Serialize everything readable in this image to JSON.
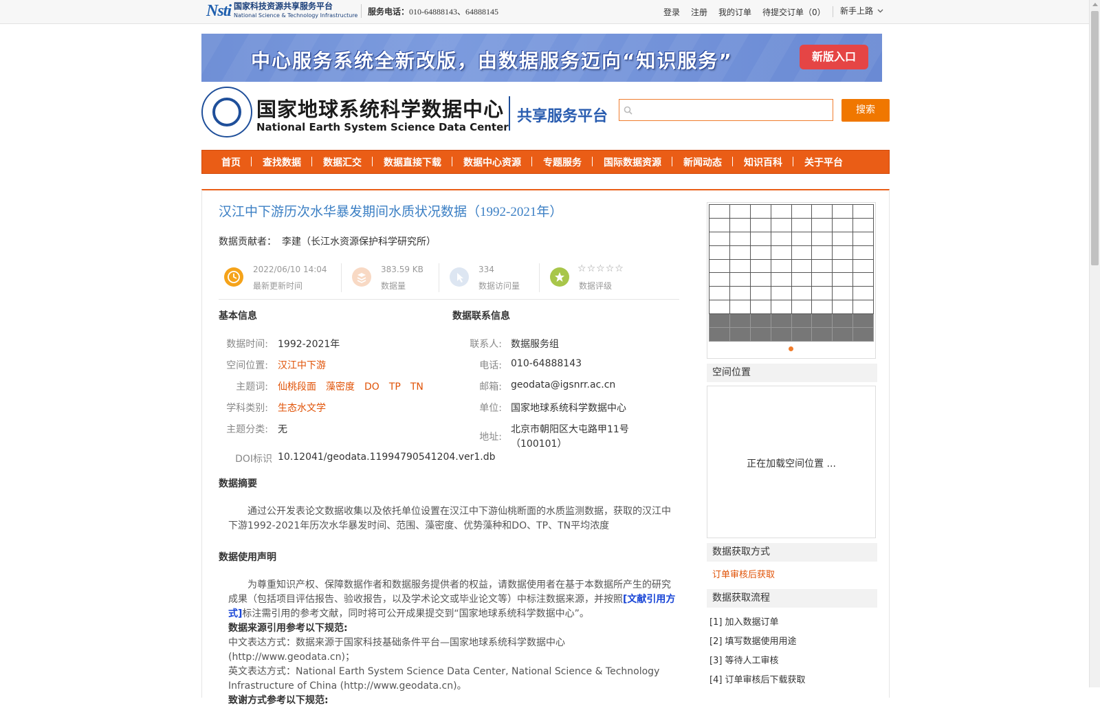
{
  "topbar": {
    "nsti_mark": "Nsti",
    "nsti_cn": "国家科技资源共享服务平台",
    "nsti_en": "National Science & Technology Infrastructure",
    "phone_label": "服务电话：",
    "phone_value": "010-64888143、64888145",
    "links": [
      "登录",
      "注册",
      "我的订单",
      "待提交订单（0）"
    ],
    "guide": "新手上路"
  },
  "banner": {
    "text": "中心服务系统全新改版，由数据服务迈向“知识服务”",
    "button": "新版入口"
  },
  "header": {
    "center_cn": "国家地球系统科学数据中心",
    "center_en": "National Earth System Science Data Center",
    "platform": "共享服务平台",
    "search_placeholder": "",
    "search_button": "搜索"
  },
  "nav": [
    "首页",
    "查找数据",
    "数据汇交",
    "数据直接下载",
    "数据中心资源",
    "专题服务",
    "国际数据资源",
    "新闻动态",
    "知识百科",
    "关于平台"
  ],
  "dataset": {
    "title": "汉江中下游历次水华暴发期间水质状况数据（1992-2021年）",
    "contributor_label": "数据贡献者：",
    "contributor": "李建（长江水资源保护科学研究所）",
    "stats": [
      {
        "value": "2022/06/10 14:04",
        "caption": "最新更新时间",
        "icon": "clock-icon",
        "color": "#f5a31a"
      },
      {
        "value": "383.59 KB",
        "caption": "数据量",
        "icon": "layers-icon",
        "color": "#f8d9c4"
      },
      {
        "value": "334",
        "caption": "数据访问量",
        "icon": "pointer-icon",
        "color": "#dde6f2"
      },
      {
        "value": "",
        "caption": "数据评级",
        "icon": "star-badge-icon",
        "color": "#a8c64a"
      }
    ],
    "rating": 0
  },
  "basic_info": {
    "heading": "基本信息",
    "rows": [
      {
        "label": "数据时间:",
        "value": "1992-2021年"
      },
      {
        "label": "空间位置:",
        "value": "汉江中下游"
      },
      {
        "label": "主题词:",
        "values": [
          "仙桃段面",
          "藻密度",
          "DO",
          "TP",
          "TN"
        ]
      },
      {
        "label": "学科类别:",
        "value": "生态水文学"
      },
      {
        "label": "主题分类:",
        "value": "无"
      },
      {
        "label": "DOI标识",
        "value": "10.12041/geodata.11994790541204.ver1.db"
      }
    ]
  },
  "contact_info": {
    "heading": "数据联系信息",
    "rows": [
      {
        "label": "联系人:",
        "value": "数据服务组"
      },
      {
        "label": "电话:",
        "value": "010-64888143"
      },
      {
        "label": "邮箱:",
        "value": "geodata@igsnrr.ac.cn"
      },
      {
        "label": "单位:",
        "value": "国家地球系统科学数据中心"
      },
      {
        "label": "地址:",
        "value_line1": "北京市朝阳区大屯路甲11号",
        "value_line2": "（100101）"
      }
    ]
  },
  "abstract": {
    "heading": "数据摘要",
    "text": "通过公开发表论文数据收集以及依托单位设置在汉江中下游仙桃断面的水质监测数据，获取的汉江中下游1992-2021年历次水华暴发时间、范围、藻密度、优势藻种和DO、TP、TN平均浓度"
  },
  "usage": {
    "heading": "数据使用声明",
    "p1_a": "为尊重知识产权、保障数据作者和数据服务提供者的权益，请数据使用者在基于本数据所产生的研究成果（包括项目评估报告、验收报告，以及学术论文或毕业论文等）中标注数据来源，并按照",
    "p1_link": "[文献引用方式]",
    "p1_b": "标注需引用的参考文献，同时将可公开成果提交到“国家地球系统科学数据中心”。",
    "source_heading": "数据来源引用参考以下规范:",
    "source_cn": "中文表达方式：数据来源于国家科技基础条件平台—国家地球系统科学数据中心(http://www.geodata.cn)；",
    "source_en": "英文表达方式：National Earth System Science Data Center, National Science & Technology Infrastructure of China (http://www.geodata.cn)。",
    "thanks_heading": "致谢方式参考以下规范:"
  },
  "sidebar": {
    "spatial_heading": "空间位置",
    "map_loading": "正在加载空间位置 ...",
    "access_heading": "数据获取方式",
    "access_value": "订单审核后获取",
    "process_heading": "数据获取流程",
    "steps": [
      "[1] 加入数据订单",
      "[2] 填写数据使用用途",
      "[3] 等待人工审核",
      "[4] 订单审核后下载获取"
    ]
  }
}
